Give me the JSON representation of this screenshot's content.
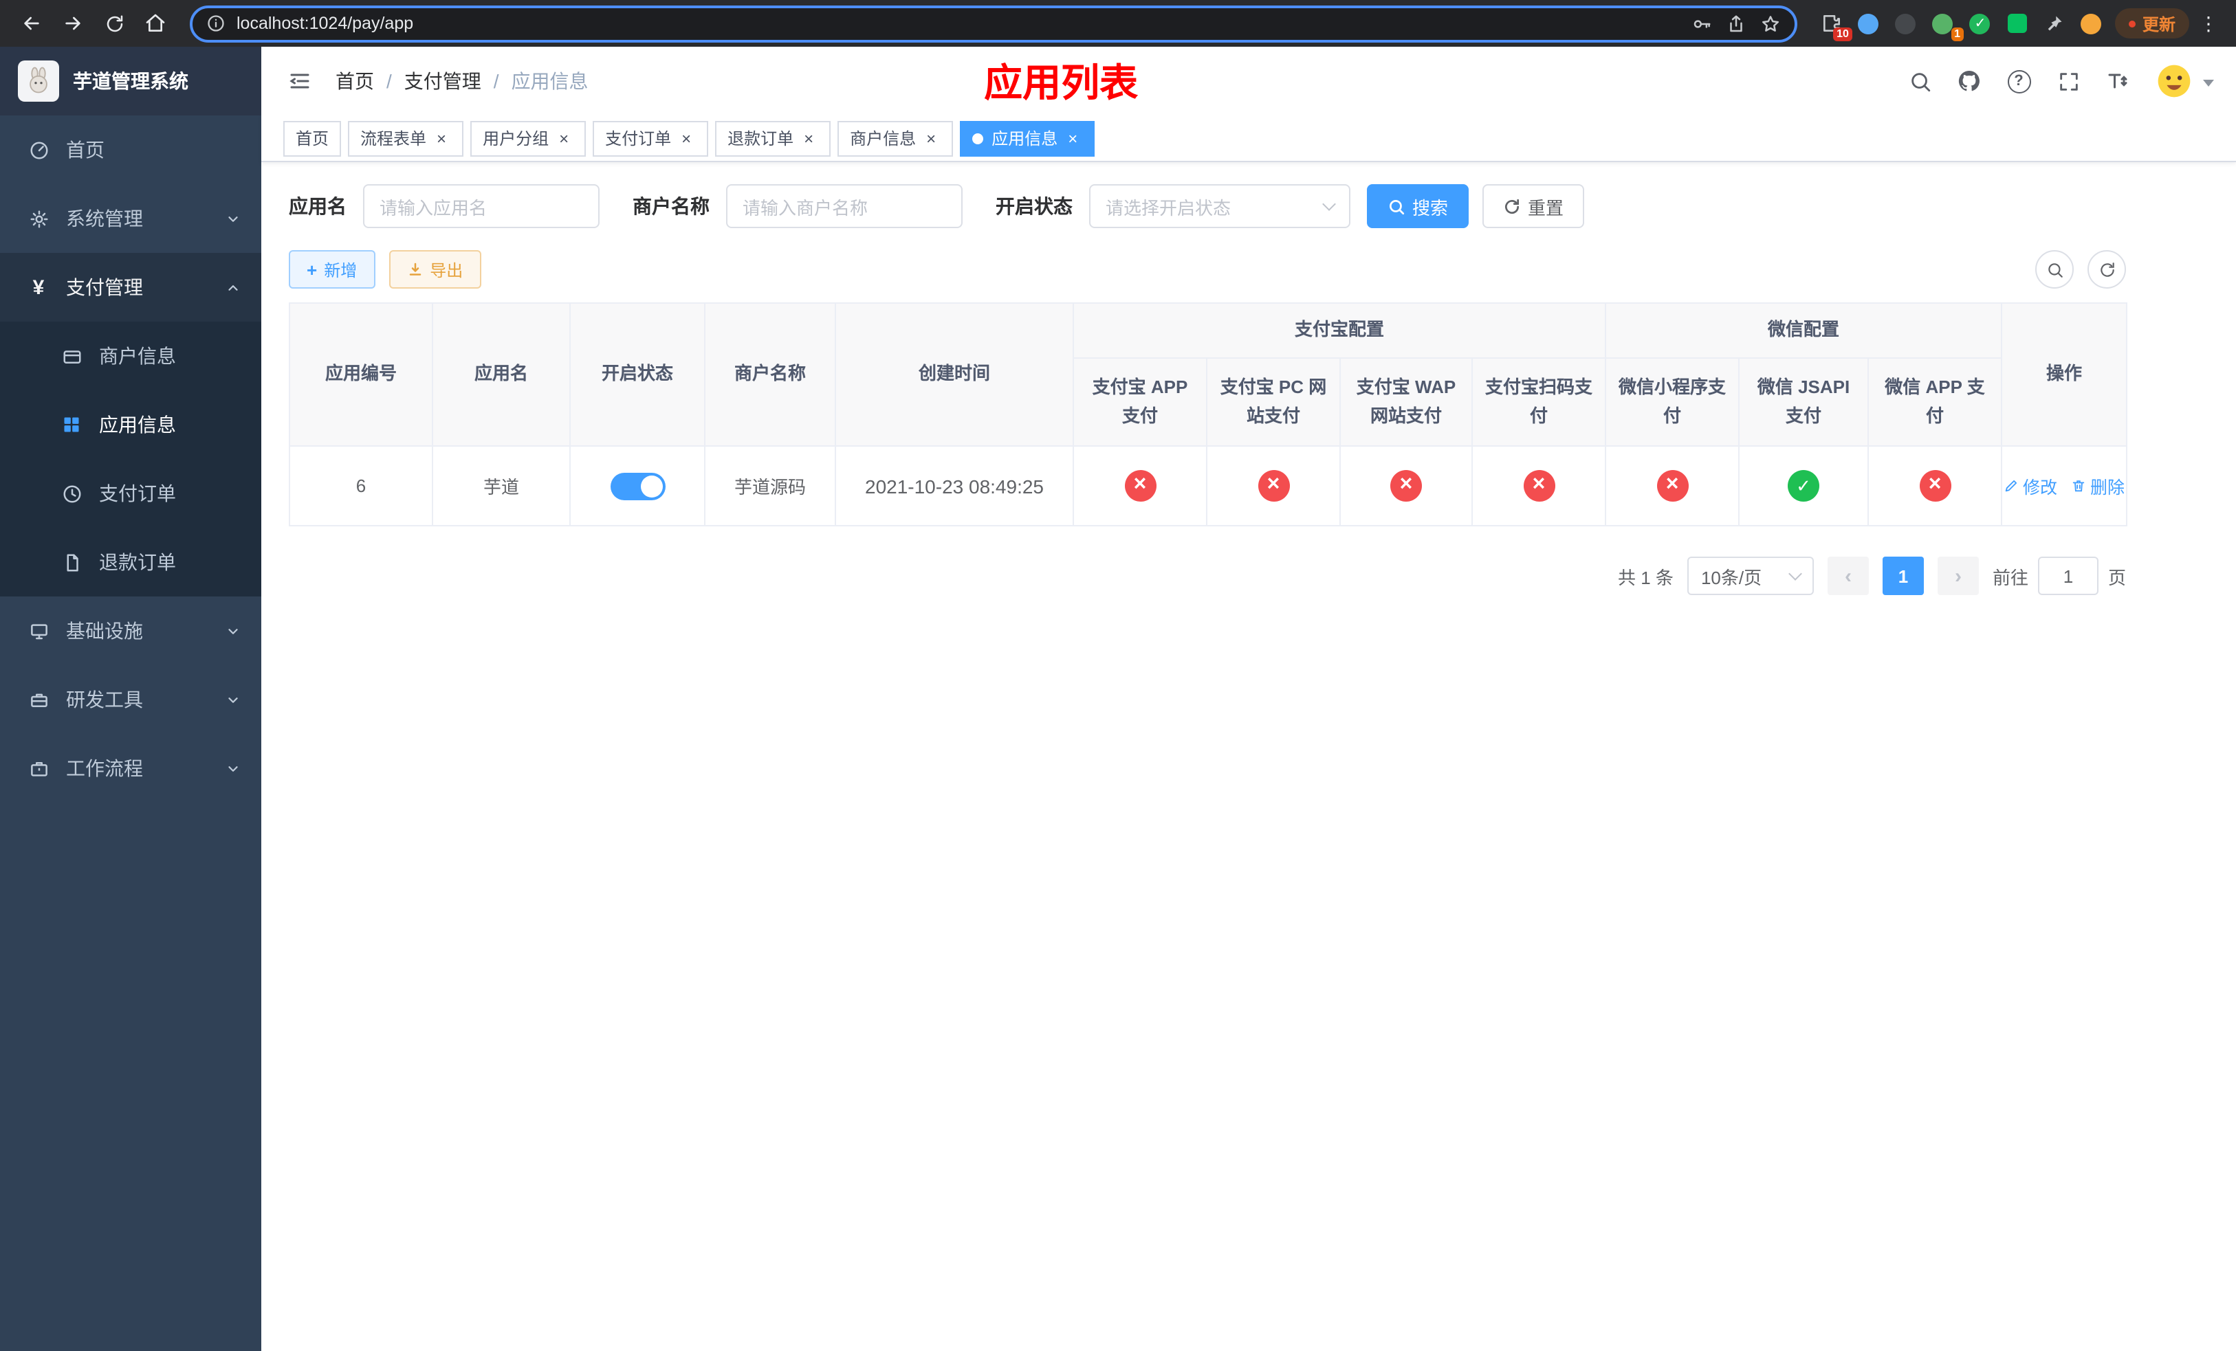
{
  "colors": {
    "accent": "#409eff",
    "danger": "#f34d4f",
    "success": "#1fbf53",
    "warning": "#e6a23c",
    "title_red": "#ff0000",
    "sidebar_bg": "#304156",
    "sidebar_submenu_bg": "#1f2d3d",
    "table_header_bg": "#f8f8f9"
  },
  "icons": {
    "back": "left-arrow",
    "forward": "right-arrow",
    "reload": "circular-arrow",
    "home": "house",
    "site-info": "circled-i",
    "key": "key",
    "share": "box-up-arrow",
    "bookmark": "star",
    "extensions": "puzzle-piece",
    "browser-menu": "vertical-dots",
    "search": "magnifier",
    "github": "octocat",
    "help": "circled-question",
    "fullscreen": "corner-arrows",
    "font-size": "letter-T-arrows",
    "hamburger": "three-bars",
    "dashboard": "gauge",
    "system": "gear",
    "payment": "yen-sign",
    "merchant": "credit-card",
    "app-info": "grid",
    "pay-order": "circle-clock",
    "refund-order": "document",
    "infrastructure": "monitor",
    "devtools": "toolbox",
    "workflow": "briefcase",
    "add": "plus",
    "export": "download-arrow",
    "edit": "pencil",
    "delete": "trash",
    "config-off": "red-circle-cross",
    "config-on": "green-circle-check"
  },
  "browser": {
    "url": "localhost:1024/pay/app",
    "badge_puzzle": "10",
    "badge_ext": "1",
    "update_button": "更新"
  },
  "sidebar": {
    "logo_title": "芋道管理系统",
    "items": [
      {
        "label": "首页"
      },
      {
        "label": "系统管理"
      },
      {
        "label": "支付管理"
      },
      {
        "label": "基础设施"
      },
      {
        "label": "研发工具"
      },
      {
        "label": "工作流程"
      }
    ],
    "payment_children": [
      {
        "label": "商户信息"
      },
      {
        "label": "应用信息"
      },
      {
        "label": "支付订单"
      },
      {
        "label": "退款订单"
      }
    ]
  },
  "header": {
    "breadcrumb": [
      "首页",
      "支付管理",
      "应用信息"
    ],
    "page_title": "应用列表"
  },
  "tabs": [
    {
      "label": "首页"
    },
    {
      "label": "流程表单"
    },
    {
      "label": "用户分组"
    },
    {
      "label": "支付订单"
    },
    {
      "label": "退款订单"
    },
    {
      "label": "商户信息"
    },
    {
      "label": "应用信息"
    }
  ],
  "filters": {
    "app_name": {
      "label": "应用名",
      "placeholder": "请输入应用名",
      "value": ""
    },
    "merchant_name": {
      "label": "商户名称",
      "placeholder": "请输入商户名称",
      "value": ""
    },
    "status": {
      "label": "开启状态",
      "placeholder": "请选择开启状态",
      "value": ""
    },
    "search_button": "搜索",
    "reset_button": "重置"
  },
  "toolbar": {
    "add_button": "新增",
    "export_button": "导出"
  },
  "table": {
    "header": {
      "app_id": "应用编号",
      "app_name": "应用名",
      "status": "开启状态",
      "merchant_name": "商户名称",
      "create_time": "创建时间",
      "alipay_group": "支付宝配置",
      "wechat_group": "微信配置",
      "alipay_app": "支付宝 APP 支付",
      "alipay_pc": "支付宝 PC 网站支付",
      "alipay_wap": "支付宝 WAP 网站支付",
      "alipay_qr": "支付宝扫码支付",
      "wx_mini": "微信小程序支付",
      "wx_jsapi": "微信 JSAPI 支付",
      "wx_app": "微信 APP 支付",
      "actions": "操作"
    },
    "rows": [
      {
        "app_id": "6",
        "app_name": "芋道",
        "status": "on",
        "merchant_name": "芋道源码",
        "create_time": "2021-10-23 08:49:25",
        "configs": [
          "off",
          "off",
          "off",
          "off",
          "off",
          "on",
          "off"
        ],
        "edit_label": "修改",
        "delete_label": "删除"
      }
    ]
  },
  "pagination": {
    "total_text": "共 1 条",
    "page_size": "10条/页",
    "current_page": "1",
    "goto_prefix": "前往",
    "goto_value": "1",
    "goto_suffix": "页"
  }
}
